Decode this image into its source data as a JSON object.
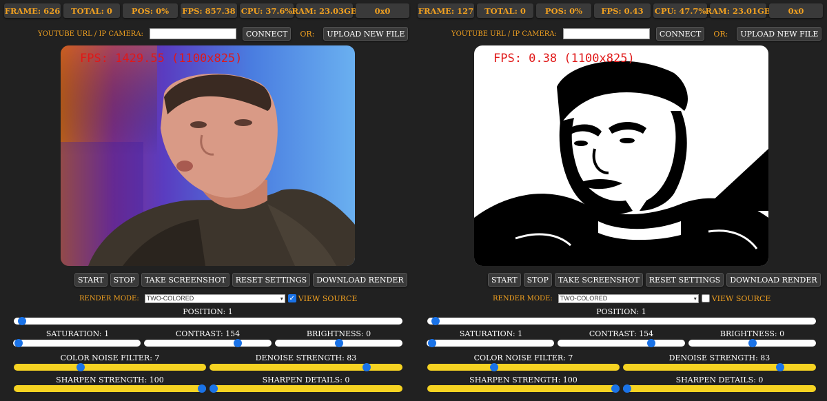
{
  "panels": [
    {
      "stats": {
        "frame": "FRAME: 626",
        "total": "TOTAL: 0",
        "pos": "POS: 0%",
        "fps": "FPS: 857.38",
        "cpu": "CPU: 37.6%",
        "ram": "RAM: 23.03GB",
        "res": "0x0"
      },
      "overlay_text": "FPS: 1429.55 (1100x825)",
      "view_source_checked": true,
      "sliders": {
        "position": {
          "label": "POSITION: 1",
          "value": 0.01
        },
        "saturation": {
          "label": "SATURATION: 1",
          "value": 0.01
        },
        "contrast": {
          "label": "CONTRAST: 154",
          "value": 0.75
        },
        "brightness": {
          "label": "BRIGHTNESS: 0",
          "value": 0.5
        },
        "color_noise": {
          "label": "COLOR NOISE FILTER: 7",
          "value": 0.34
        },
        "denoise": {
          "label": "DENOISE STRENGTH: 83",
          "value": 0.83
        },
        "sharpen_strength": {
          "label": "SHARPEN STRENGTH: 100",
          "value": 1.0
        },
        "sharpen_details": {
          "label": "SHARPEN DETAILS: 0",
          "value": 0.0
        }
      }
    },
    {
      "stats": {
        "frame": "FRAME: 127",
        "total": "TOTAL: 0",
        "pos": "POS: 0%",
        "fps": "FPS: 0.43",
        "cpu": "CPU: 47.7%",
        "ram": "RAM: 23.01GB",
        "res": "0x0"
      },
      "overlay_text": "FPS: 0.38 (1100x825)",
      "view_source_checked": false,
      "sliders": {
        "position": {
          "label": "POSITION: 1",
          "value": 0.01
        },
        "saturation": {
          "label": "SATURATION: 1",
          "value": 0.01
        },
        "contrast": {
          "label": "CONTRAST: 154",
          "value": 0.75
        },
        "brightness": {
          "label": "BRIGHTNESS: 0",
          "value": 0.5
        },
        "color_noise": {
          "label": "COLOR NOISE FILTER: 7",
          "value": 0.34
        },
        "denoise": {
          "label": "DENOISE STRENGTH: 83",
          "value": 0.83
        },
        "sharpen_strength": {
          "label": "SHARPEN STRENGTH: 100",
          "value": 1.0
        },
        "sharpen_details": {
          "label": "SHARPEN DETAILS: 0",
          "value": 0.0
        }
      }
    }
  ],
  "common": {
    "url_label": "YOUTUBE URL / IP CAMERA:",
    "url_value": "",
    "connect_label": "CONNECT",
    "or_label": "OR:",
    "upload_label": "UPLOAD NEW FILE",
    "start_label": "START",
    "stop_label": "STOP",
    "screenshot_label": "TAKE SCREENSHOT",
    "reset_label": "RESET SETTINGS",
    "download_label": "DOWNLOAD RENDER",
    "render_mode_label": "RENDER MODE:",
    "render_mode_value": "TWO-COLORED",
    "view_source_label": "VIEW SOURCE"
  },
  "colors": {
    "accent": "#f0a020",
    "slider_thumb": "#1a73e8",
    "slider_yellow": "#f6d322",
    "overlay_red": "#e01818"
  }
}
